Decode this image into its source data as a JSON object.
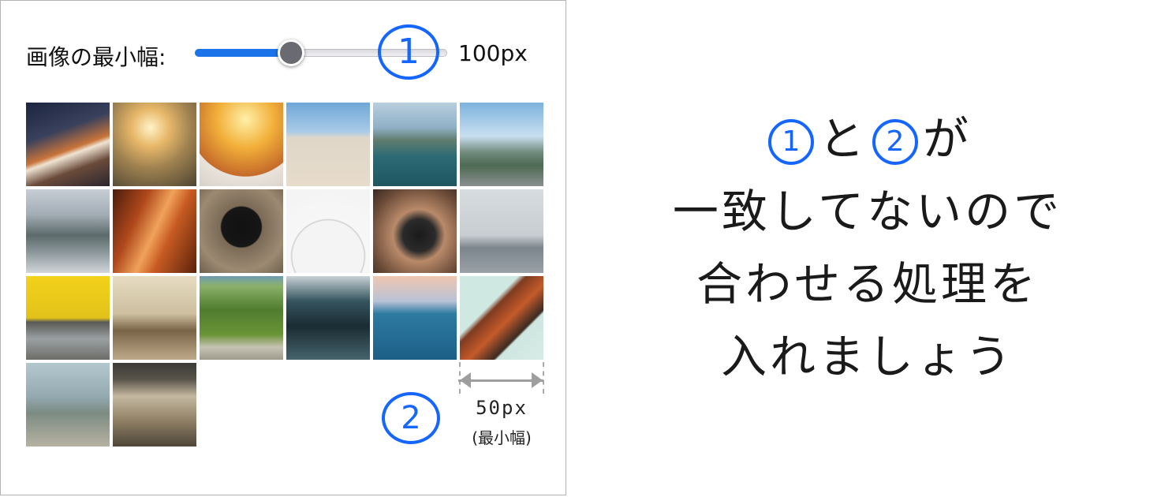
{
  "slider": {
    "label": "画像の最小幅:",
    "value_text": "100px",
    "fill_fraction": 0.38,
    "accent_color": "#1a73e8"
  },
  "markers": {
    "one": "1",
    "two": "2",
    "color": "#1565ff"
  },
  "gallery": {
    "images": [
      {
        "name": "light-trails-photo"
      },
      {
        "name": "woman-sunset-photo"
      },
      {
        "name": "strawberries-photo"
      },
      {
        "name": "beach-photo"
      },
      {
        "name": "coast-cliffs-photo"
      },
      {
        "name": "mountain-road-photo"
      },
      {
        "name": "misty-mountain-photo"
      },
      {
        "name": "antelope-canyon-photo"
      },
      {
        "name": "black-dog-photo"
      },
      {
        "name": "ferris-wheel-photo"
      },
      {
        "name": "camera-hands-photo"
      },
      {
        "name": "foggy-bridge-photo"
      },
      {
        "name": "vintage-cars-photo"
      },
      {
        "name": "bench-couple-photo"
      },
      {
        "name": "tennis-court-photo"
      },
      {
        "name": "escalator-photo"
      },
      {
        "name": "sea-rock-photo"
      },
      {
        "name": "stadium-roof-photo"
      },
      {
        "name": "skateboarder-photo"
      },
      {
        "name": "clothes-rack-photo"
      }
    ]
  },
  "measure": {
    "size_label": "50px",
    "note": "(最小幅)"
  },
  "message": {
    "line1_and": "と",
    "line1_ga": "が",
    "line2": "一致してないので",
    "line3": "合わせる処理を",
    "line4": "入れましょう"
  }
}
